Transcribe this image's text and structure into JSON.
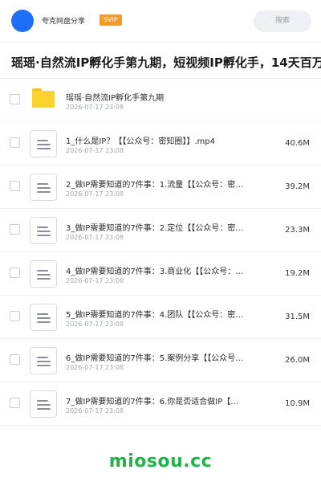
{
  "header": {
    "brand": "夸克网盘分享",
    "badge": "SVIP",
    "search_placeholder": "搜索"
  },
  "title_bar": {
    "title": "瑶瑶·自然流IP孵化手第九期，短视频IP孵化手，14天百万"
  },
  "files": [
    {
      "name": "瑶瑶·自然流IP孵化手第九期",
      "date": "2026-07-17 23:08",
      "size": "",
      "type": "folder"
    },
    {
      "name": "1_什么是IP？【【公众号：密知圈】】.mp4",
      "date": "2026-07-17 23:08",
      "size": "40.6M",
      "type": "file"
    },
    {
      "name": "2_做IP需要知道的7件事：1.流量【【公众号：密…",
      "date": "2026-07-17 23:08",
      "size": "39.2M",
      "type": "file"
    },
    {
      "name": "3_做IP需要知道的7件事：2.定位【【公众号：密…",
      "date": "2026-07-17 23:08",
      "size": "23.3M",
      "type": "file"
    },
    {
      "name": "4_做IP需要知道的7件事：3.商业化【【公众号：…",
      "date": "2026-07-17 23:08",
      "size": "19.2M",
      "type": "file"
    },
    {
      "name": "5_做IP需要知道的7件事：4.团队【【公众号：密…",
      "date": "2026-07-17 23:08",
      "size": "31.5M",
      "type": "file"
    },
    {
      "name": "6_做IP需要知道的7件事：5.案例分享【【公众号…",
      "date": "2026-07-17 23:08",
      "size": "26.0M",
      "type": "file"
    },
    {
      "name": "7_做IP需要知道的7件事：6.你是否适合做IP【…",
      "date": "2026-07-17 23:08",
      "size": "10.9M",
      "type": "file"
    }
  ],
  "watermark": "miosou.cc",
  "colors": {
    "accent": "#1e6ff5",
    "badge": "#f39b27",
    "folder": "#fcd22f",
    "watermark": "#22b24c"
  }
}
